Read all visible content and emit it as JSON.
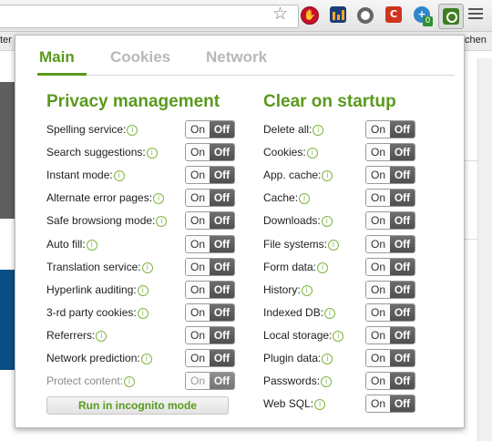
{
  "browser": {
    "bookmarks_left": "ter",
    "bookmarks_right": "chen",
    "extensions": [
      "stop-extension-icon",
      "chart-extension-icon",
      "ring-extension-icon",
      "c-extension-icon",
      "globe-extension-icon",
      "privacy-extension-icon"
    ],
    "globe_badge": "0"
  },
  "tabs": [
    {
      "label": "Main",
      "active": true
    },
    {
      "label": "Cookies",
      "active": false
    },
    {
      "label": "Network",
      "active": false
    }
  ],
  "privacy": {
    "title": "Privacy management",
    "items": [
      {
        "label": "Spelling service:",
        "on": "On",
        "off": "Off"
      },
      {
        "label": "Search suggestions:",
        "on": "On",
        "off": "Off"
      },
      {
        "label": "Instant mode:",
        "on": "On",
        "off": "Off"
      },
      {
        "label": "Alternate error pages:",
        "on": "On",
        "off": "Off"
      },
      {
        "label": "Safe browsiong mode:",
        "on": "On",
        "off": "Off"
      },
      {
        "label": "Auto fill:",
        "on": "On",
        "off": "Off"
      },
      {
        "label": "Translation service:",
        "on": "On",
        "off": "Off"
      },
      {
        "label": "Hyperlink auditing:",
        "on": "On",
        "off": "Off"
      },
      {
        "label": "3-rd party cookies:",
        "on": "On",
        "off": "Off"
      },
      {
        "label": "Referrers:",
        "on": "On",
        "off": "Off"
      },
      {
        "label": "Network prediction:",
        "on": "On",
        "off": "Off"
      },
      {
        "label": "Protect content:",
        "on": "On",
        "off": "Off"
      }
    ]
  },
  "clear": {
    "title": "Clear on startup",
    "items": [
      {
        "label": "Delete all:",
        "on": "On",
        "off": "Off"
      },
      {
        "label": "Cookies:",
        "on": "On",
        "off": "Off"
      },
      {
        "label": "App. cache:",
        "on": "On",
        "off": "Off"
      },
      {
        "label": "Cache:",
        "on": "On",
        "off": "Off"
      },
      {
        "label": "Downloads:",
        "on": "On",
        "off": "Off"
      },
      {
        "label": "File systems:",
        "on": "On",
        "off": "Off"
      },
      {
        "label": "Form data:",
        "on": "On",
        "off": "Off"
      },
      {
        "label": "History:",
        "on": "On",
        "off": "Off"
      },
      {
        "label": "Indexed DB:",
        "on": "On",
        "off": "Off"
      },
      {
        "label": "Local storage:",
        "on": "On",
        "off": "Off"
      },
      {
        "label": "Plugin data:",
        "on": "On",
        "off": "Off"
      },
      {
        "label": "Passwords:",
        "on": "On",
        "off": "Off"
      },
      {
        "label": "Web SQL:",
        "on": "On",
        "off": "Off"
      }
    ]
  },
  "incognito_button": "Run in incognito mode",
  "info_glyph": "i",
  "colors": {
    "accent": "#5a9a1c",
    "toggle_off": "#555555"
  }
}
